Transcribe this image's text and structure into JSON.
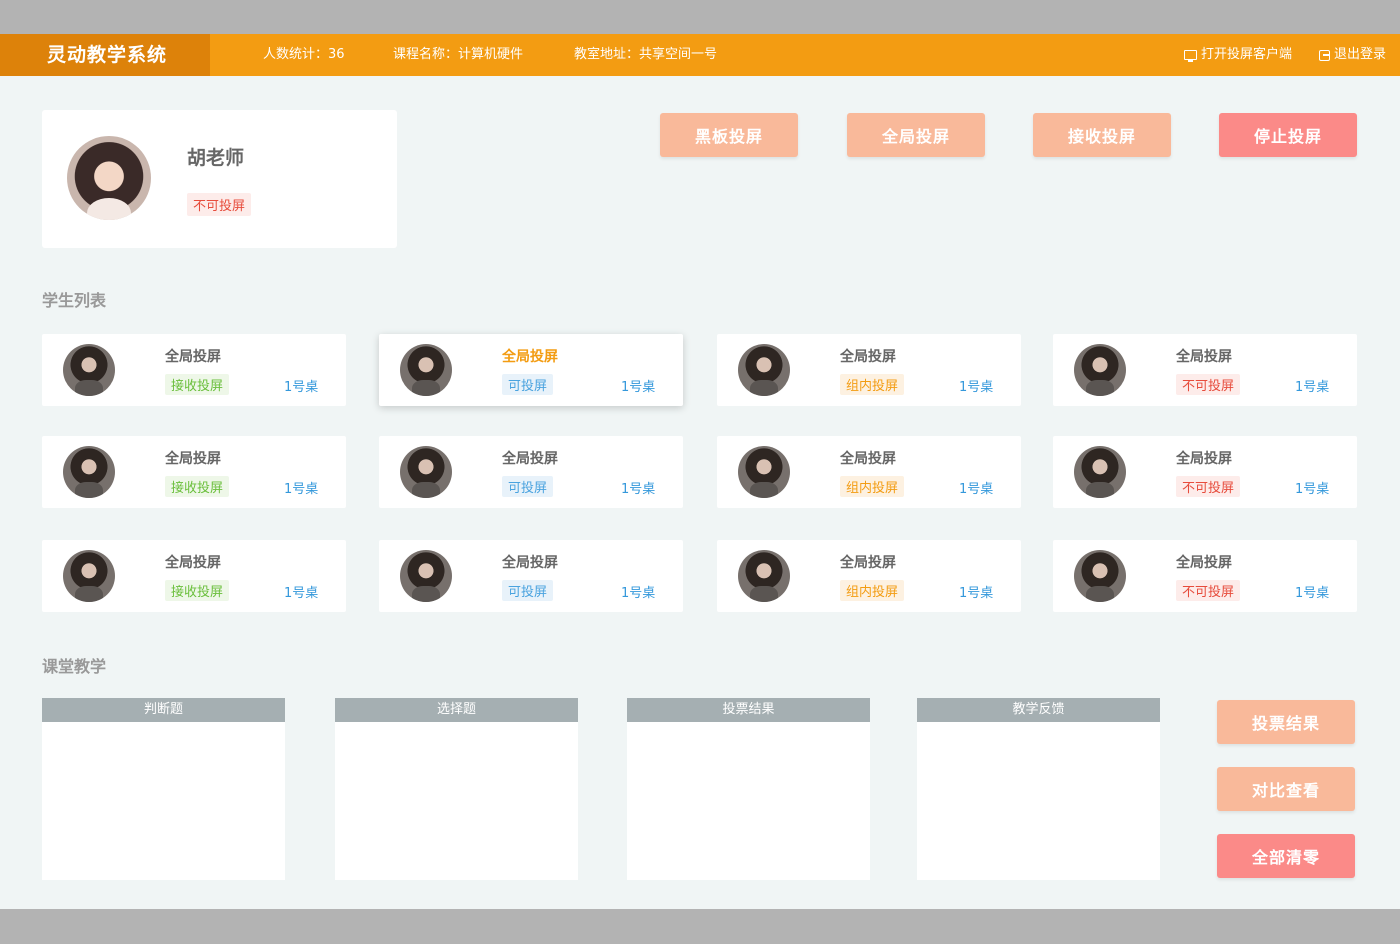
{
  "header": {
    "brand": "灵动教学系统",
    "count_label": "人数统计：36",
    "course_label": "课程名称：计算机硬件",
    "room_label": "教室地址：共享空间一号",
    "open_client": "打开投屏客户端",
    "logout": "退出登录"
  },
  "teacher": {
    "name": "胡老师",
    "status": "不可投屏"
  },
  "top_buttons": [
    {
      "label": "黑板投屏",
      "color": "#f9b99a"
    },
    {
      "label": "全局投屏",
      "color": "#f9b99a"
    },
    {
      "label": "接收投屏",
      "color": "#f9b99a"
    },
    {
      "label": "停止投屏",
      "color": "#fb8a88"
    }
  ],
  "students_title": "学生列表",
  "students": [
    {
      "title": "全局投屏",
      "status": "接收投屏",
      "desk": "1号桌"
    },
    {
      "title": "全局投屏",
      "status": "可投屏",
      "desk": "1号桌"
    },
    {
      "title": "全局投屏",
      "status": "组内投屏",
      "desk": "1号桌"
    },
    {
      "title": "全局投屏",
      "status": "不可投屏",
      "desk": "1号桌"
    },
    {
      "title": "全局投屏",
      "status": "接收投屏",
      "desk": "1号桌"
    },
    {
      "title": "全局投屏",
      "status": "可投屏",
      "desk": "1号桌"
    },
    {
      "title": "全局投屏",
      "status": "组内投屏",
      "desk": "1号桌"
    },
    {
      "title": "全局投屏",
      "status": "不可投屏",
      "desk": "1号桌"
    },
    {
      "title": "全局投屏",
      "status": "接收投屏",
      "desk": "1号桌"
    },
    {
      "title": "全局投屏",
      "status": "可投屏",
      "desk": "1号桌"
    },
    {
      "title": "全局投屏",
      "status": "组内投屏",
      "desk": "1号桌"
    },
    {
      "title": "全局投屏",
      "status": "不可投屏",
      "desk": "1号桌"
    }
  ],
  "status_colors": {
    "receive": {
      "fg": "#6abf3b",
      "bg": "#eef7e8"
    },
    "can": {
      "fg": "#4aa3df",
      "bg": "#e8f2fa"
    },
    "group": {
      "fg": "#f39c12",
      "bg": "#fdf1e1"
    },
    "cannot": {
      "fg": "#e74c3c",
      "bg": "#fdecea"
    }
  },
  "classroom_title": "课堂教学",
  "panels": [
    {
      "label": "判断题"
    },
    {
      "label": "选择题"
    },
    {
      "label": "投票结果"
    },
    {
      "label": "教学反馈"
    }
  ],
  "side_buttons": [
    {
      "label": "投票结果",
      "color": "#f9b99a"
    },
    {
      "label": "对比查看",
      "color": "#f9b99a"
    },
    {
      "label": "全部清零",
      "color": "#fb8a88"
    }
  ]
}
